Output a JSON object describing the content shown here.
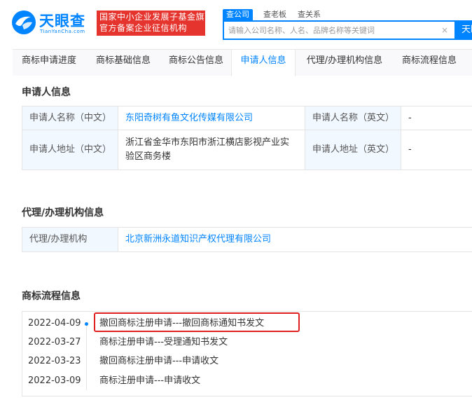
{
  "header": {
    "logo_text": "天眼查",
    "logo_sub": "TianYanCha.com",
    "badge_line1": "国家中小企业发展子基金旗下",
    "badge_line2": "官方备案企业征信机构",
    "search_tabs": [
      {
        "label": "查公司",
        "active": true
      },
      {
        "label": "查老板",
        "active": false
      },
      {
        "label": "查关系",
        "active": false
      }
    ],
    "search_placeholder": "请输入公司名称、人名、品牌名称等关键词",
    "search_button": "天眼"
  },
  "nav": {
    "tabs": [
      {
        "label": "商标申请进度",
        "active": false
      },
      {
        "label": "商标基础信息",
        "active": false
      },
      {
        "label": "商标公告信息",
        "active": false
      },
      {
        "label": "申请人信息",
        "active": true
      },
      {
        "label": "代理/办理机构信息",
        "active": false
      },
      {
        "label": "商标流程信息",
        "active": false
      }
    ]
  },
  "applicant": {
    "title": "申请人信息",
    "name_cn_label": "申请人名称（中文）",
    "name_cn_value": "东阳奇树有鱼文化传媒有限公司",
    "name_en_label": "申请人名称（英文）",
    "name_en_value": "-",
    "addr_cn_label": "申请人地址（中文）",
    "addr_cn_value": "浙江省金华市东阳市浙江横店影视产业实验区商务楼",
    "addr_en_label": "申请人地址（英文）",
    "addr_en_value": "-"
  },
  "agency": {
    "title": "代理/办理机构信息",
    "label": "代理/办理机构",
    "value": "北京新洲永道知识产权代理有限公司"
  },
  "flow": {
    "title": "商标流程信息",
    "items": [
      {
        "date": "2022-04-09",
        "text": "撤回商标注册申请---撤回商标通知书发文"
      },
      {
        "date": "2022-03-27",
        "text": "商标注册申请---受理通知书发文"
      },
      {
        "date": "2022-03-23",
        "text": "撤回商标注册申请---申请收文"
      },
      {
        "date": "2022-03-09",
        "text": "商标注册申请---申请收文"
      }
    ]
  },
  "colors": {
    "brand": "#0084ff",
    "badge": "#e5332d",
    "highlight": "#e02020",
    "label_bg": "#f2f8ff"
  }
}
